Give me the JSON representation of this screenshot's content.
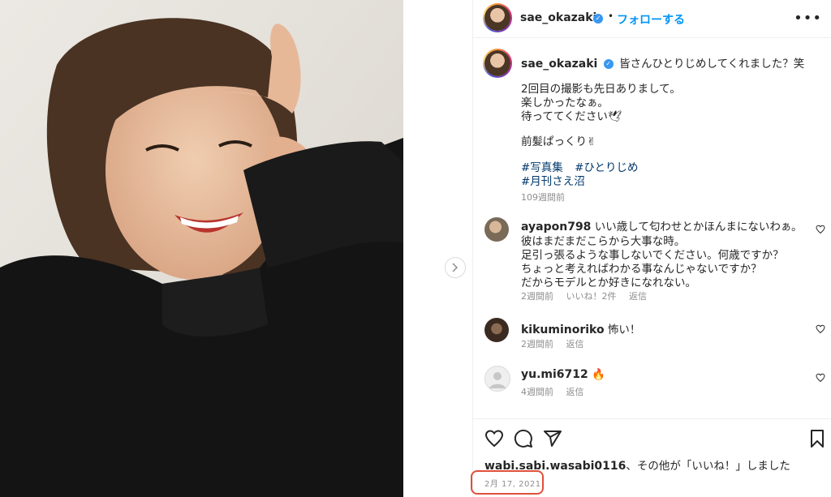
{
  "post": {
    "username": "sae_okazaki",
    "follow_label": "フォローする",
    "separator": "•",
    "more_label": "•••"
  },
  "caption": {
    "username": "sae_okazaki",
    "line1": "皆さんひとりじめしてくれました？笑",
    "line2": "2回目の撮影も先日ありまして。",
    "line3": "楽しかったなぁ。",
    "line4": "待っててください🕊",
    "line5": "前髪ぱっくり✌︎",
    "tag1": "#写真集",
    "tag2": "#ひとりじめ",
    "tag3": "#月刊さえ沼",
    "time": "109週間前"
  },
  "comments": [
    {
      "username": "ayapon798",
      "lines": [
        "いい歳して匂わせとかほんまにないわぁ。",
        "彼はまだまだこらから大事な時。",
        "足引っ張るような事しないでください。何歳ですか？",
        "ちょっと考えればわかる事なんじゃないですか？",
        "だからモデルとか好きになれない。"
      ],
      "time": "2週間前",
      "likes": "いいね！2件",
      "reply": "返信"
    },
    {
      "username": "kikuminoriko",
      "text": "怖い！",
      "time": "2週間前",
      "reply": "返信"
    },
    {
      "username": "yu.mi6712",
      "text": "🔥",
      "time": "4週間前",
      "reply": "返信"
    }
  ],
  "footer": {
    "liked_by_user": "wabi.sabi.wasabi0116",
    "liked_by_rest": "、その他が「いいね！」しました",
    "liked_by_bold": "その他",
    "date": "2月 17, 2021"
  },
  "icons": {
    "heart": "heart-icon",
    "comment": "comment-icon",
    "share": "share-icon",
    "bookmark": "bookmark-icon",
    "next": "chevron-right-icon"
  },
  "colors": {
    "link": "#0095f6",
    "hashtag": "#00376b",
    "highlight": "#e0503a"
  }
}
